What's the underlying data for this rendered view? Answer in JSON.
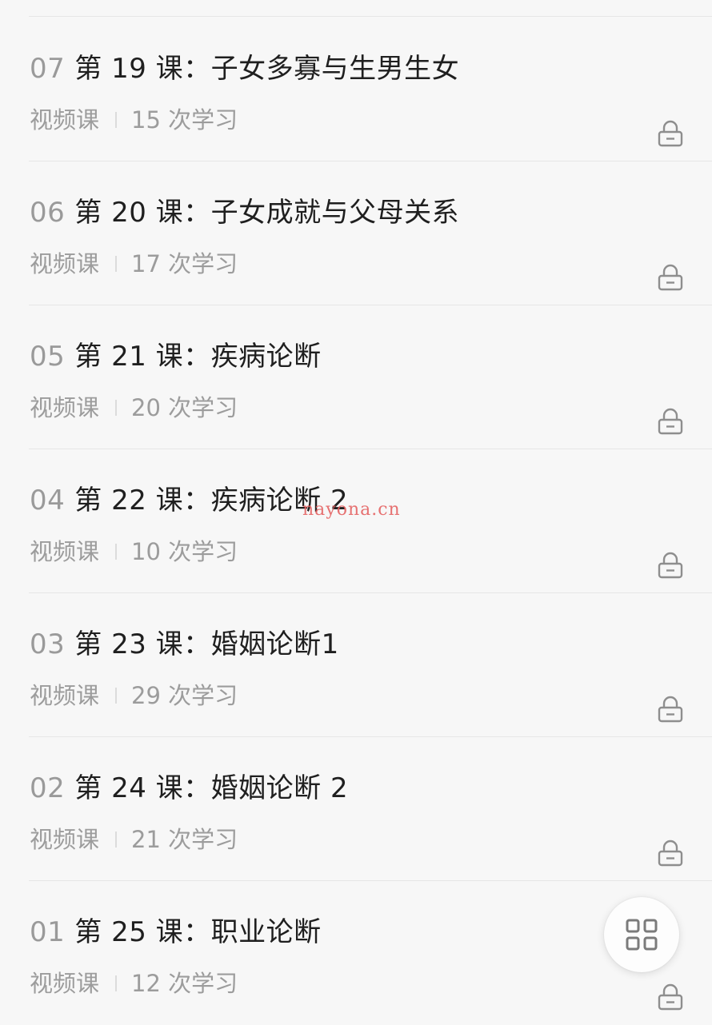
{
  "lessons": [
    {
      "index": "07",
      "title": "第 19 课：子女多寡与生男生女",
      "type": "视频课",
      "views": "15 次学习"
    },
    {
      "index": "06",
      "title": "第 20 课：子女成就与父母关系",
      "type": "视频课",
      "views": "17 次学习"
    },
    {
      "index": "05",
      "title": "第 21 课：疾病论断",
      "type": "视频课",
      "views": "20 次学习"
    },
    {
      "index": "04",
      "title": "第 22 课：疾病论断 2",
      "type": "视频课",
      "views": "10 次学习"
    },
    {
      "index": "03",
      "title": "第 23 课：婚姻论断1",
      "type": "视频课",
      "views": "29 次学习"
    },
    {
      "index": "02",
      "title": "第 24 课：婚姻论断 2",
      "type": "视频课",
      "views": "21 次学习"
    },
    {
      "index": "01",
      "title": "第 25 课：职业论断",
      "type": "视频课",
      "views": "12 次学习"
    }
  ],
  "watermark": "nayona.cn",
  "icons": {
    "lock": "lock-icon",
    "fab": "grid-menu-icon"
  },
  "colors": {
    "background": "#f7f7f7",
    "title": "#1f1f1f",
    "muted": "#9c9c9c",
    "watermark": "#e45a5a"
  }
}
